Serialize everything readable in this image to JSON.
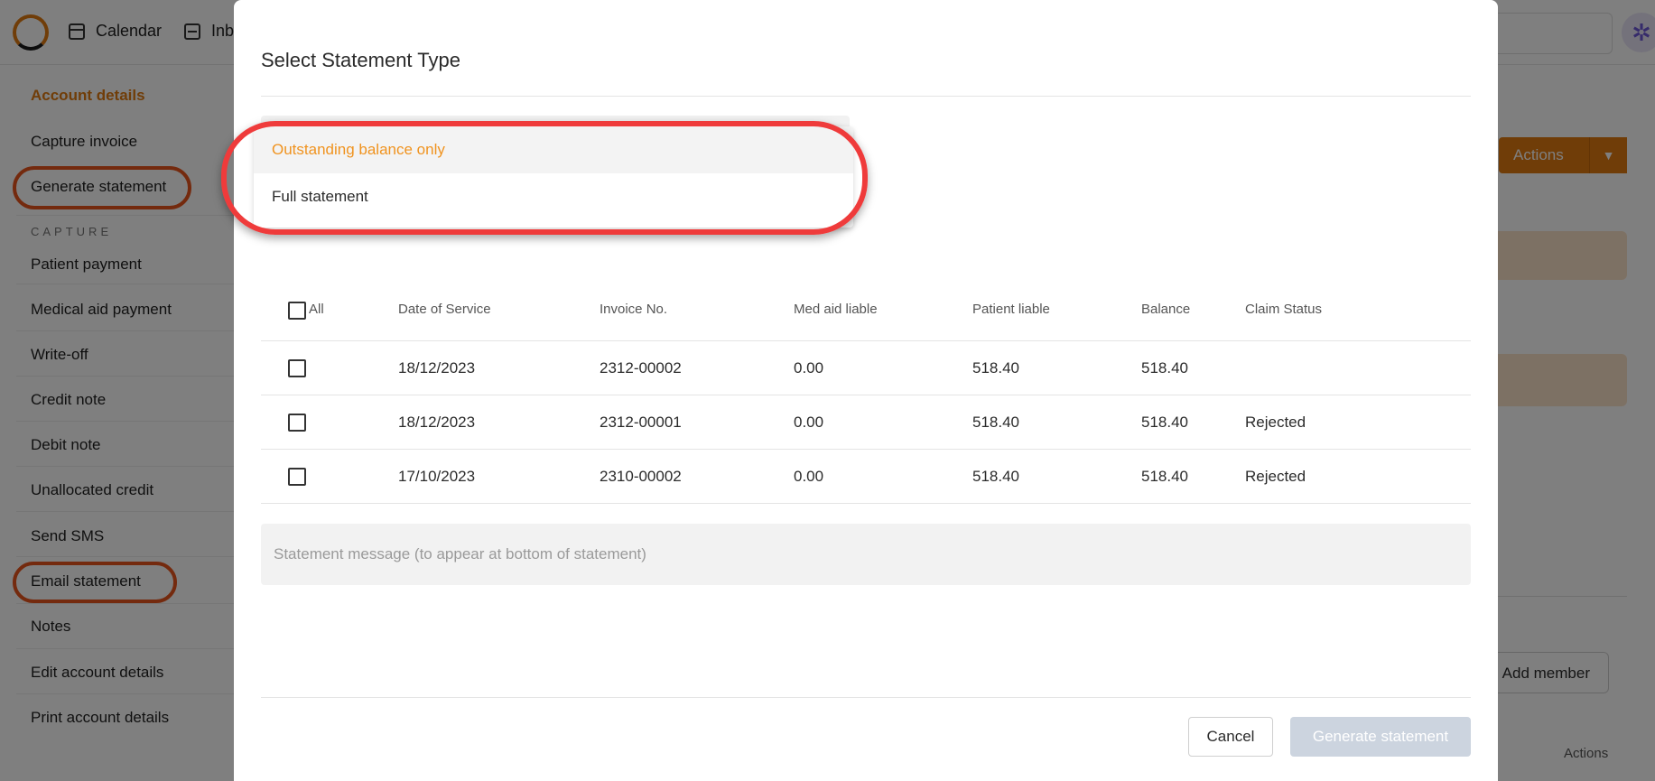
{
  "topnav": {
    "calendar_label": "Calendar",
    "inbox_label": "Inb"
  },
  "sidebar": {
    "account_details": "Account details",
    "capture_invoice": "Capture invoice",
    "generate_statement": "Generate statement",
    "capture_section": "CAPTURE",
    "patient_payment": "Patient payment",
    "medical_aid_payment": "Medical aid payment",
    "write_off": "Write-off",
    "credit_note": "Credit note",
    "debit_note": "Debit note",
    "unallocated_credit": "Unallocated credit",
    "send_sms": "Send SMS",
    "email_statement": "Email statement",
    "notes": "Notes",
    "edit_account_details": "Edit account details",
    "print_account_details": "Print account details"
  },
  "background": {
    "actions_label": "Actions",
    "add_member_label": "Add member",
    "table_actions_label": "Actions"
  },
  "modal": {
    "title": "Select Statement Type",
    "dropdown_options": {
      "outstanding": "Outstanding balance only",
      "full": "Full statement"
    },
    "table": {
      "headers": {
        "all": "All",
        "date_of_service": "Date of Service",
        "invoice_no": "Invoice No.",
        "med_aid_liable": "Med aid liable",
        "patient_liable": "Patient liable",
        "balance": "Balance",
        "claim_status": "Claim Status"
      },
      "rows": [
        {
          "date": "18/12/2023",
          "invoice": "2312-00002",
          "med_aid": "0.00",
          "patient": "518.40",
          "balance": "518.40",
          "status": ""
        },
        {
          "date": "18/12/2023",
          "invoice": "2312-00001",
          "med_aid": "0.00",
          "patient": "518.40",
          "balance": "518.40",
          "status": "Rejected"
        },
        {
          "date": "17/10/2023",
          "invoice": "2310-00002",
          "med_aid": "0.00",
          "patient": "518.40",
          "balance": "518.40",
          "status": "Rejected"
        }
      ]
    },
    "message_placeholder": "Statement message (to appear at bottom of statement)",
    "cancel_label": "Cancel",
    "generate_label": "Generate statement"
  },
  "colors": {
    "accent": "#e07a10",
    "selected_option": "#f0931f",
    "highlight_ring_red": "#ef3b3b",
    "highlight_ring_orange": "#e8551d"
  }
}
